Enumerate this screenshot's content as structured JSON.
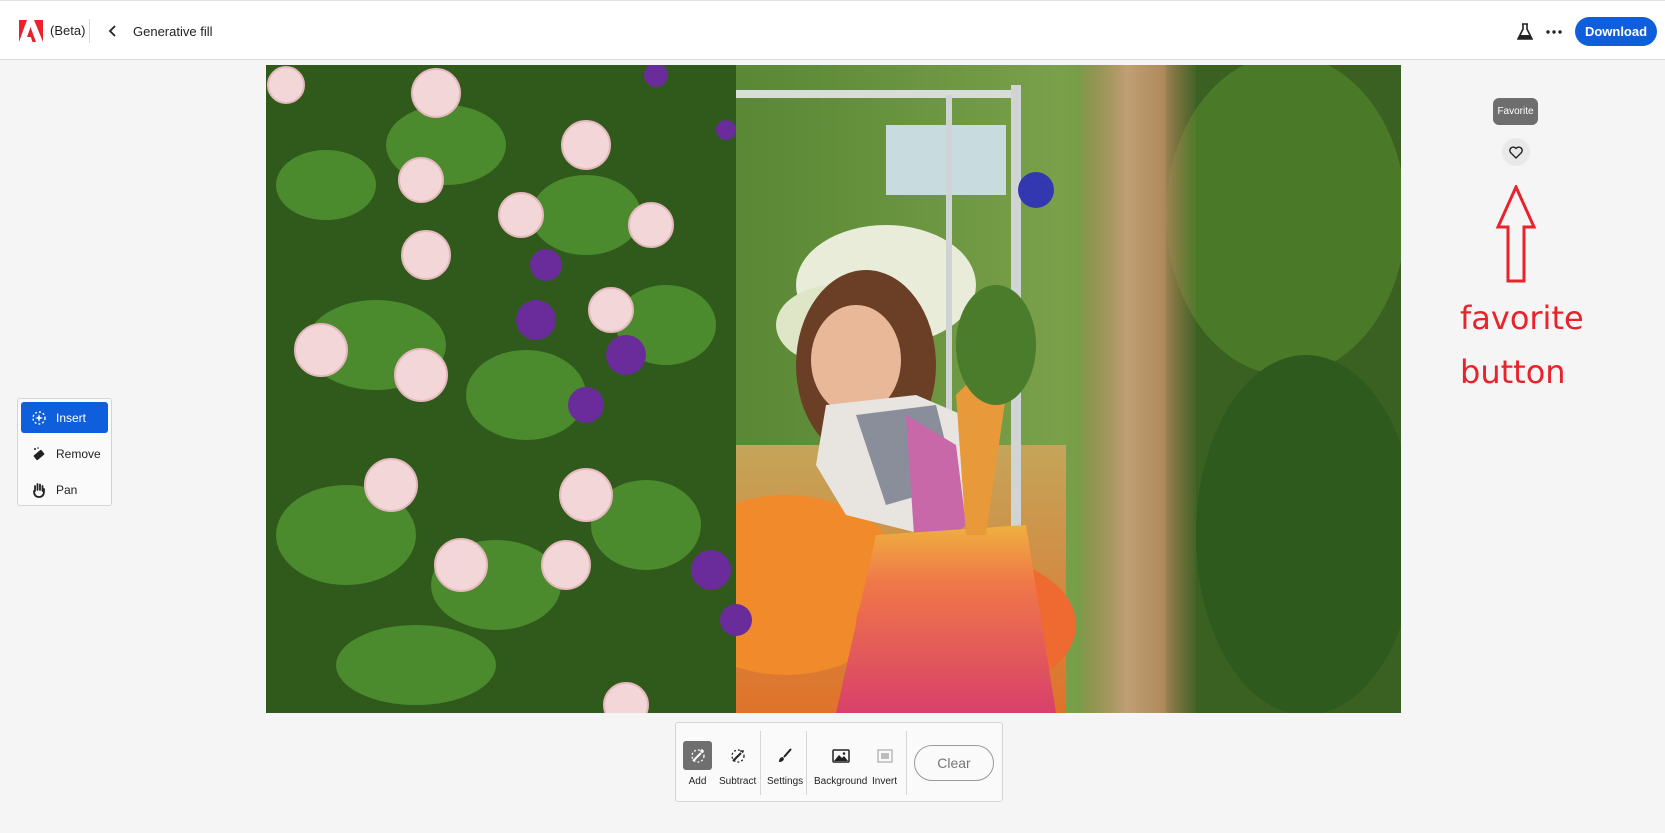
{
  "header": {
    "beta_label": "(Beta)",
    "title": "Generative fill",
    "download_label": "Download",
    "back_icon": "chevron-left-icon",
    "labs_icon": "flask-icon",
    "more_icon": "ellipsis-icon"
  },
  "tools": [
    {
      "label": "Insert",
      "icon": "insert-sparkle-icon",
      "active": true
    },
    {
      "label": "Remove",
      "icon": "eraser-icon",
      "active": false
    },
    {
      "label": "Pan",
      "icon": "hand-icon",
      "active": false
    }
  ],
  "favorite": {
    "tooltip": "Favorite",
    "icon": "heart-icon"
  },
  "annotation": {
    "line1": "favorite",
    "line2": "button",
    "color": "#e8232b"
  },
  "bottom_toolbar": {
    "add_label": "Add",
    "subtract_label": "Subtract",
    "settings_label": "Settings",
    "background_label": "Background",
    "invert_label": "Invert",
    "clear_label": "Clear"
  },
  "colors": {
    "accent": "#0f5fdc"
  }
}
